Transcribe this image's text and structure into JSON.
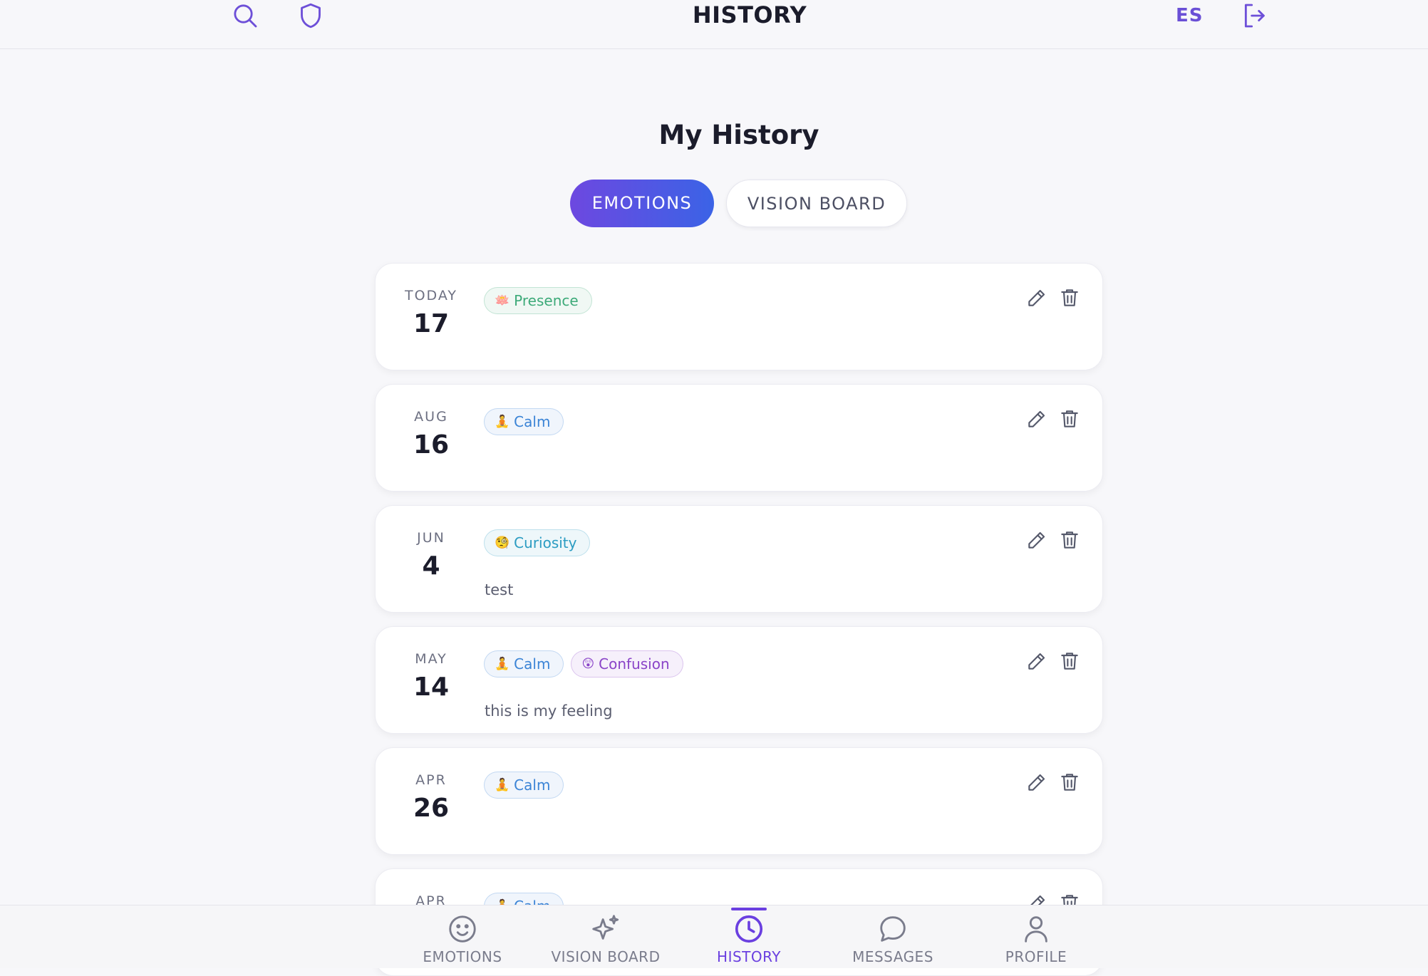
{
  "header": {
    "title": "HISTORY",
    "language": "ES",
    "left_icons": [
      "search-icon",
      "shield-icon"
    ],
    "right_icon": "logout-icon"
  },
  "page": {
    "title": "My History",
    "tabs": [
      {
        "label": "EMOTIONS",
        "active": true
      },
      {
        "label": "VISION BOARD",
        "active": false
      }
    ]
  },
  "entries": [
    {
      "month": "TODAY",
      "day": "17",
      "tags": [
        {
          "emoji": "🪷",
          "label": "Presence",
          "color": "#3daa79"
        }
      ],
      "note": ""
    },
    {
      "month": "AUG",
      "day": "16",
      "tags": [
        {
          "emoji": "🧘",
          "label": "Calm",
          "color": "#3b84d6"
        }
      ],
      "note": ""
    },
    {
      "month": "JUN",
      "day": "4",
      "tags": [
        {
          "emoji": "🧐",
          "label": "Curiosity",
          "color": "#2b9cc2"
        }
      ],
      "note": "test"
    },
    {
      "month": "MAY",
      "day": "14",
      "tags": [
        {
          "emoji": "🧘",
          "label": "Calm",
          "color": "#3b84d6"
        },
        {
          "emoji": "😲",
          "label": "Confusion",
          "color": "#8a44c8"
        }
      ],
      "note": "this is my feeling"
    },
    {
      "month": "APR",
      "day": "26",
      "tags": [
        {
          "emoji": "🧘",
          "label": "Calm",
          "color": "#3b84d6"
        }
      ],
      "note": ""
    },
    {
      "month": "APR",
      "day": "",
      "tags": [
        {
          "emoji": "🧘",
          "label": "Calm",
          "color": "#3b84d6"
        }
      ],
      "note": ""
    }
  ],
  "actions": {
    "edit_icon": "pencil-icon",
    "delete_icon": "trash-icon"
  },
  "bottom_nav": [
    {
      "label": "EMOTIONS",
      "icon": "smile-icon",
      "active": false
    },
    {
      "label": "VISION BOARD",
      "icon": "sparkles-icon",
      "active": false
    },
    {
      "label": "HISTORY",
      "icon": "clock-icon",
      "active": true
    },
    {
      "label": "MESSAGES",
      "icon": "chat-bubble-icon",
      "active": false
    },
    {
      "label": "PROFILE",
      "icon": "user-icon",
      "active": false
    }
  ],
  "colors": {
    "accent": "#6a3fe0",
    "accent_gradient_end": "#3b63e6",
    "background": "#f7f7fa"
  }
}
